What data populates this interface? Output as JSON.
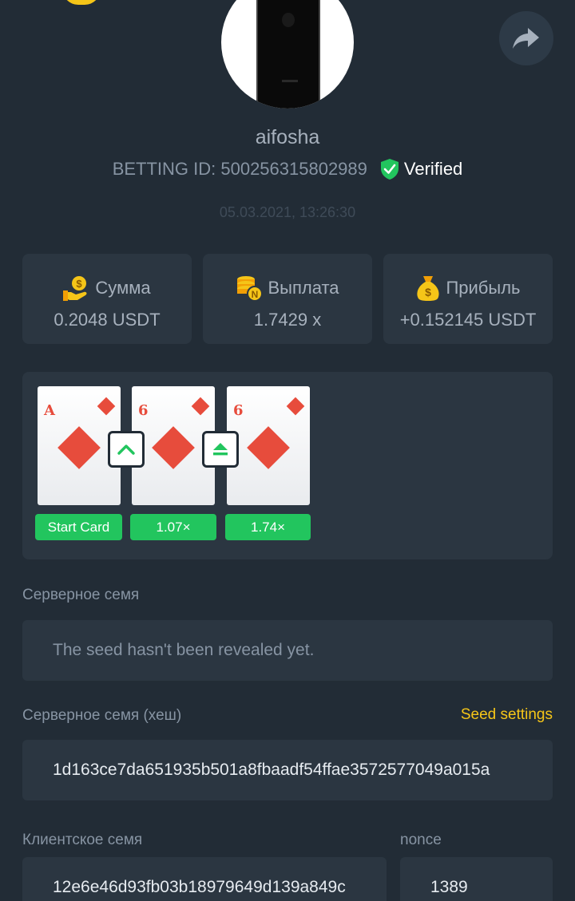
{
  "profile": {
    "username": "aifosha",
    "betting_id": "BETTING ID: 500256315802989",
    "verified_label": "Verified",
    "timestamp": "05.03.2021, 13:26:30"
  },
  "stats": [
    {
      "label": "Сумма",
      "value": "0.2048 USDT",
      "icon": "hand-coin-icon"
    },
    {
      "label": "Выплата",
      "value": "1.7429 x",
      "icon": "coin-stack-icon"
    },
    {
      "label": "Прибыль",
      "value": "+0.152145 USDT",
      "icon": "money-bag-icon"
    }
  ],
  "game": {
    "cards": [
      {
        "rank": "A",
        "suit": "diamond"
      },
      {
        "rank": "6",
        "suit": "diamond"
      },
      {
        "rank": "6",
        "suit": "diamond"
      }
    ],
    "guesses": [
      "higher-icon",
      "higher-or-equal-icon"
    ],
    "multipliers": [
      "Start Card",
      "1.07×",
      "1.74×"
    ]
  },
  "fairness": {
    "server_seed_label": "Серверное семя",
    "server_seed_value": "The seed hasn't been revealed yet.",
    "server_seed_hash_label": "Серверное семя (хеш)",
    "seed_settings_link": "Seed settings",
    "server_seed_hash_value": "1d163ce7da651935b501a8fbaadf54ffae3572577049a015a",
    "client_seed_label": "Клиентское семя",
    "client_seed_value": "12e6e46d93fb03b18979649d139a849c",
    "nonce_label": "nonce",
    "nonce_value": "1389"
  },
  "colors": {
    "background": "#222c36",
    "card_panel": "#2b3641",
    "accent_green": "#22c55e",
    "accent_yellow": "#f5c518",
    "suit_red": "#e74c3c"
  }
}
